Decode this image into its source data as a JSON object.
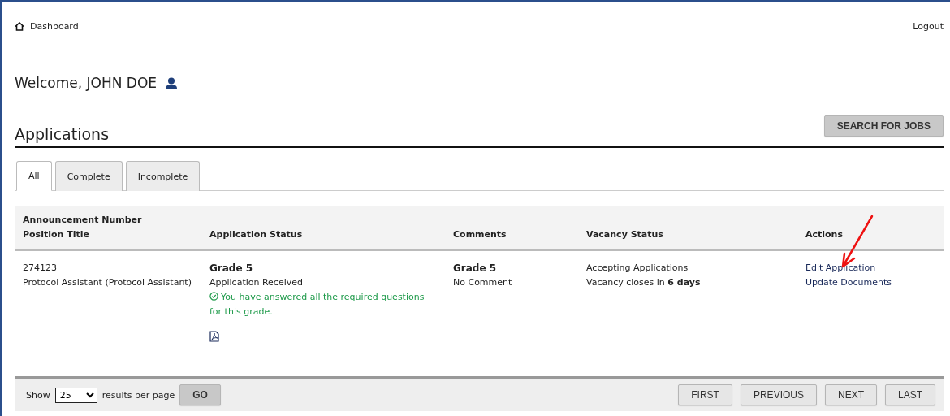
{
  "nav": {
    "dashboard": "Dashboard",
    "logout": "Logout"
  },
  "welcome": "Welcome, JOHN DOE",
  "section": {
    "title": "Applications",
    "search_button": "SEARCH FOR JOBS"
  },
  "tabs": [
    {
      "label": "All",
      "selected": true
    },
    {
      "label": "Complete",
      "selected": false
    },
    {
      "label": "Incomplete",
      "selected": false
    }
  ],
  "table": {
    "columns": [
      {
        "lines": [
          "Announcement Number",
          "Position Title"
        ]
      },
      {
        "lines": [
          "Application Status"
        ]
      },
      {
        "lines": [
          "Comments"
        ]
      },
      {
        "lines": [
          "Vacancy Status"
        ]
      },
      {
        "lines": [
          "Actions"
        ]
      }
    ],
    "rows": [
      {
        "announcement_number": "274123",
        "position_title": "Protocol Assistant (Protocol Assistant)",
        "grade": "Grade 5",
        "application_status": "Application Received",
        "questions_note": "You have answered all the required questions for this grade.",
        "comment_grade": "Grade 5",
        "comment": "No Comment",
        "vacancy_status": "Accepting Applications",
        "vacancy_closes": "Vacancy closes in **6 days**",
        "actions": [
          "Edit Application",
          "Update Documents"
        ]
      }
    ]
  },
  "pager": {
    "show": "Show",
    "per_page": "25",
    "results_label": "results per page",
    "go": "GO",
    "buttons": [
      "FIRST",
      "PREVIOUS",
      "NEXT",
      "LAST"
    ]
  }
}
